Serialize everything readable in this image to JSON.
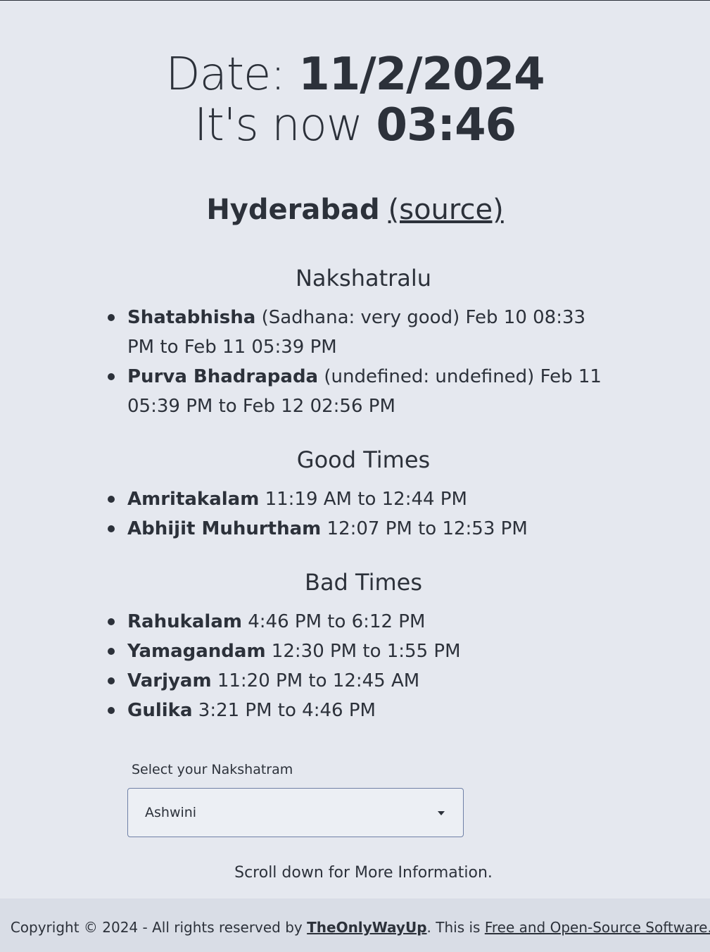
{
  "header": {
    "date_label": "Date: ",
    "date_value": "11/2/2024",
    "now_label": "It's now ",
    "time_value": "03:46"
  },
  "location": {
    "city": "Hyderabad",
    "source_link": "(source)"
  },
  "nakshatralu": {
    "title": "Nakshatralu",
    "items": [
      {
        "name": "Shatabhisha",
        "detail": " (Sadhana: very good) Feb 10 08:33 PM to Feb 11 05:39 PM"
      },
      {
        "name": "Purva Bhadrapada",
        "detail": " (undefined: undefined) Feb 11 05:39 PM to Feb 12 02:56 PM"
      }
    ]
  },
  "good_times": {
    "title": "Good Times",
    "items": [
      {
        "name": "Amritakalam",
        "detail": " 11:19 AM to 12:44 PM"
      },
      {
        "name": "Abhijit Muhurtham",
        "detail": " 12:07 PM to 12:53 PM"
      }
    ]
  },
  "bad_times": {
    "title": "Bad Times",
    "items": [
      {
        "name": "Rahukalam",
        "detail": " 4:46 PM to 6:12 PM"
      },
      {
        "name": "Yamagandam",
        "detail": " 12:30 PM to 1:55 PM"
      },
      {
        "name": "Varjyam",
        "detail": " 11:20 PM to 12:45 AM"
      },
      {
        "name": "Gulika",
        "detail": " 3:21 PM to 4:46 PM"
      }
    ]
  },
  "nakshatram_select": {
    "label": "Select your Nakshatram",
    "selected": "Ashwini"
  },
  "scroll_note": "Scroll down for More Information.",
  "footer": {
    "copyright": "Copyright © 2024 - All rights reserved by ",
    "author_link": "TheOnlyWayUp",
    "middle": ". This is ",
    "license_link": "Free and Open-Source Software.",
    "end": "."
  }
}
